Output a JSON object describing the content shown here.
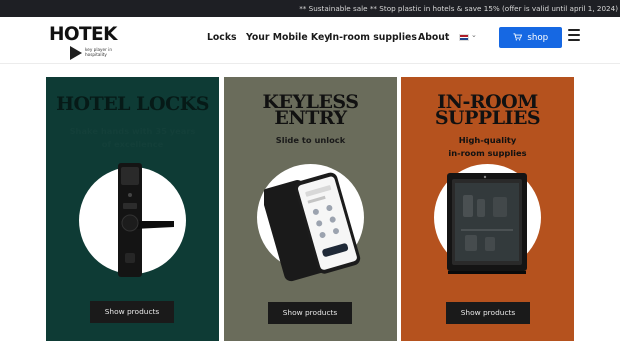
{
  "announcement": "** Sustainable sale ** Stop plastic in hotels & save 15% (offer is valid until april 1, 2024)",
  "logo": {
    "wordmark": "HOTEK",
    "tagline": "key player in hospitality"
  },
  "nav": {
    "items": [
      "Locks",
      "Your Mobile Key",
      "In-room supplies",
      "About"
    ],
    "language_flag": "Dutch flag",
    "shop_label": "shop"
  },
  "colors": {
    "card_locks": "#0e3b35",
    "card_keyless": "#6a6c5b",
    "card_supplies": "#b5521e",
    "shop_button": "#1668e3"
  },
  "cards": [
    {
      "title": "HOTEL LOCKS",
      "subtitle": "Shake hands with 35 years\nof excellence",
      "image": "door-handle-lock",
      "button": "Show products"
    },
    {
      "title": "KEYLESS\nENTRY",
      "subtitle": "Slide to unlock",
      "image": "smartphone-mobile-key",
      "button": "Show products"
    },
    {
      "title": "IN-ROOM\nSUPPLIES",
      "subtitle": "High-quality\nin-room supplies",
      "image": "minibar-fridge",
      "button": "Show products"
    }
  ]
}
